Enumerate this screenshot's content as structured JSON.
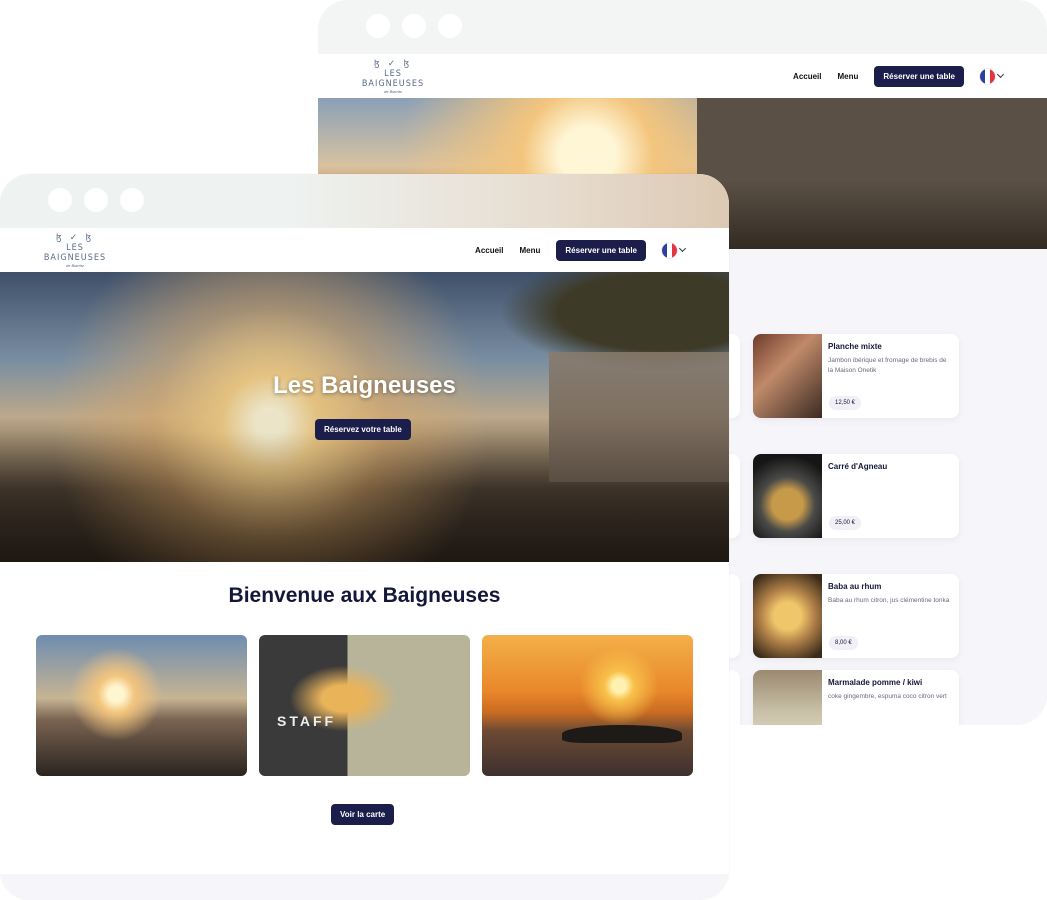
{
  "brand": {
    "mark": "ɮ ✓ ɮ",
    "name": "LES BAIGNEUSES",
    "sub": "de Biarritz"
  },
  "nav": {
    "home": "Accueil",
    "menu": "Menu",
    "reserve": "Réserver une table",
    "language": "FR"
  },
  "hero": {
    "title": "Les Baigneuses",
    "cta": "Réservez votre table"
  },
  "welcome": {
    "heading": "Bienvenue aux Baigneuses",
    "staff_text": "STAFF",
    "cta": "Voir la carte"
  },
  "menu_cards": [
    {
      "title": "Planche mixte",
      "description": "Jambon ibérique et fromage de brebis de la Maison Onetik",
      "price": "12,50 €"
    },
    {
      "title": "Carré d'Agneau",
      "description": "",
      "price": "25,00 €"
    },
    {
      "title": "Baba au rhum",
      "description": "Baba au rhum citron, jus clémentine tonka",
      "price": "8,00 €"
    },
    {
      "title": "Marmalade pomme / kiwi",
      "description": "coke gingembre, espuma coco citron vert",
      "price": ""
    }
  ],
  "colors": {
    "accent": "#1b1e4b",
    "flag": [
      "#2f3f9e",
      "#ffffff",
      "#e5333f"
    ]
  }
}
